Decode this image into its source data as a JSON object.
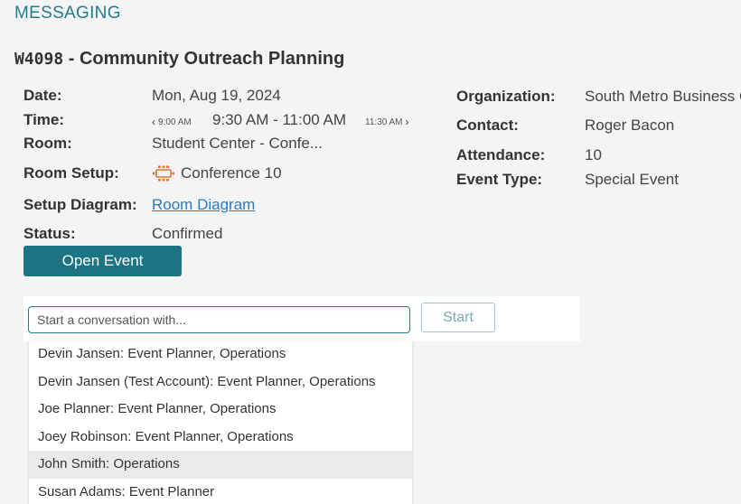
{
  "header": {
    "section": "MESSAGING"
  },
  "event": {
    "code": "W4098",
    "name": " - Community Outreach Planning"
  },
  "details_left": {
    "date_label": "Date:",
    "date_value": "Mon, Aug 19, 2024",
    "time_label": "Time:",
    "time_prev": "9:00 AM",
    "time_value": "9:30 AM - 11:00 AM",
    "time_next": "11:30 AM",
    "room_label": "Room:",
    "room_value": "Student Center - Confe...",
    "room_setup_label": "Room Setup:",
    "room_setup_value": "Conference 10",
    "room_setup_icon": "conference-table-icon",
    "diagram_label": "Setup Diagram:",
    "diagram_link": "Room Diagram",
    "status_label": "Status:",
    "status_value": "Confirmed"
  },
  "details_right": {
    "org_label": "Organization:",
    "org_value": "South Metro Business C",
    "contact_label": "Contact:",
    "contact_value": "Roger Bacon",
    "attendance_label": "Attendance:",
    "attendance_value": "10",
    "type_label": "Event Type:",
    "type_value": "Special Event"
  },
  "actions": {
    "open_event": "Open Event"
  },
  "conversation": {
    "placeholder": "Start a conversation with...",
    "start_label": "Start",
    "options": [
      "Devin Jansen: Event Planner, Operations",
      "Devin Jansen (Test Account): Event Planner, Operations",
      "Joe Planner: Event Planner, Operations",
      "Joey Robinson: Event Planner, Operations",
      "John Smith: Operations",
      "Susan Adams: Event Planner"
    ],
    "highlighted_index": 4
  },
  "colors": {
    "accent": "#1f7d8c",
    "primary_button": "#1d7485",
    "link": "#2a7bbf",
    "setup_icon": "#e8743b"
  }
}
